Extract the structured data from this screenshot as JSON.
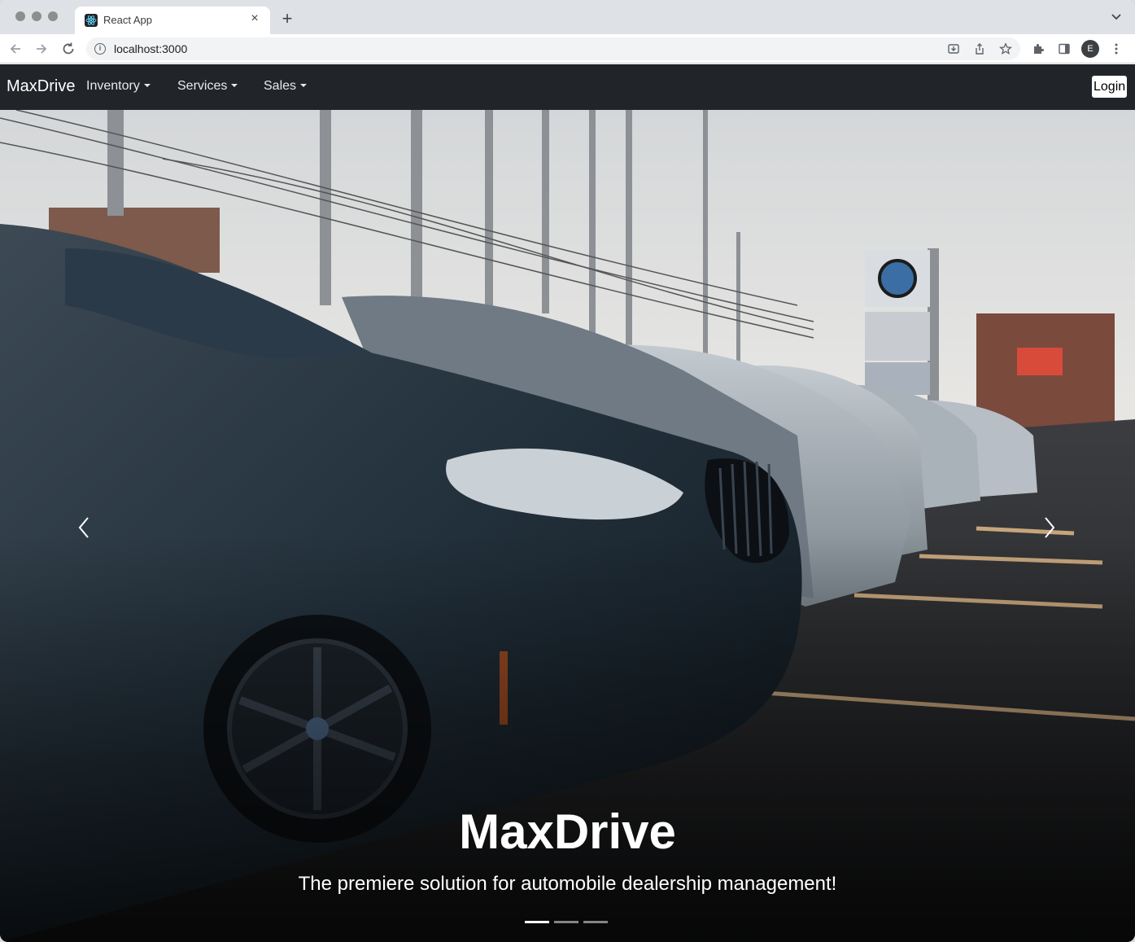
{
  "browser": {
    "tab_title": "React App",
    "tab_close": "×",
    "new_tab": "+",
    "url": "localhost:3000",
    "profile_initial": "E",
    "icons": [
      "back-icon",
      "forward-icon",
      "reload-icon",
      "info-icon",
      "install-icon",
      "share-icon",
      "star-icon",
      "extensions-icon",
      "sidepanel-icon",
      "kebab-menu-icon"
    ]
  },
  "navbar": {
    "brand": "MaxDrive",
    "items": [
      {
        "label": "Inventory"
      },
      {
        "label": "Services"
      },
      {
        "label": "Sales"
      }
    ],
    "login_label": "Login"
  },
  "hero": {
    "title": "MaxDrive",
    "subtitle": "The premiere solution for automobile dealership management!",
    "slide_count": 3,
    "active_slide": 1
  },
  "colors": {
    "navbar_bg": "#212529",
    "tabstrip_bg": "#dee1e6",
    "text_on_dark": "#ffffff"
  }
}
